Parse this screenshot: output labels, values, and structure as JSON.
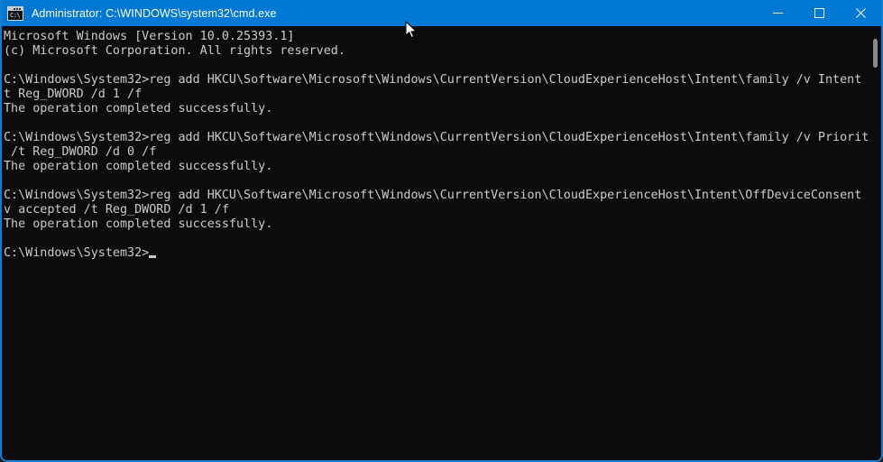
{
  "window": {
    "title": "Administrator: C:\\WINDOWS\\system32\\cmd.exe",
    "icon": "cmd-console-icon",
    "icon_prompt_text": "C:\\",
    "titlebar_color": "#0078d4",
    "border_color": "#0f7fd4",
    "console_background": "#0c0c0c",
    "console_foreground": "#cccccc"
  },
  "window_controls": {
    "minimize_label": "Minimize",
    "maximize_label": "Maximize",
    "close_label": "Close"
  },
  "console": {
    "lines": [
      "Microsoft Windows [Version 10.0.25393.1]",
      "(c) Microsoft Corporation. All rights reserved.",
      "",
      "C:\\Windows\\System32>reg add HKCU\\Software\\Microsoft\\Windows\\CurrentVersion\\CloudExperienceHost\\Intent\\family /v Intent /",
      "t Reg_DWORD /d 1 /f",
      "The operation completed successfully.",
      "",
      "C:\\Windows\\System32>reg add HKCU\\Software\\Microsoft\\Windows\\CurrentVersion\\CloudExperienceHost\\Intent\\family /v Priority",
      " /t Reg_DWORD /d 0 /f",
      "The operation completed successfully.",
      "",
      "C:\\Windows\\System32>reg add HKCU\\Software\\Microsoft\\Windows\\CurrentVersion\\CloudExperienceHost\\Intent\\OffDeviceConsent /",
      "v accepted /t Reg_DWORD /d 1 /f",
      "The operation completed successfully.",
      ""
    ],
    "prompt": "C:\\Windows\\System32>"
  },
  "scrollbar": {
    "thumb_color": "#8a8a8a"
  }
}
